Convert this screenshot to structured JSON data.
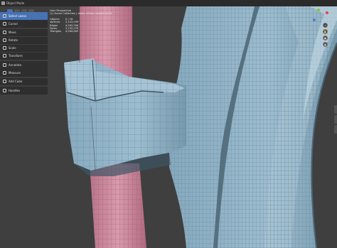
{
  "header": {
    "mode_label": "Object Mode"
  },
  "toolbar_buttons": [
    "select-box",
    "select-lasso",
    "select-circle",
    "select-tweak"
  ],
  "tools": [
    {
      "label": "Select Lasso",
      "icon": "lasso-select-icon",
      "active": true
    },
    {
      "label": "Cursor",
      "icon": "cursor-icon",
      "active": false
    },
    {
      "label": "Move",
      "icon": "move-icon",
      "active": false
    },
    {
      "label": "Rotate",
      "icon": "rotate-icon",
      "active": false
    },
    {
      "label": "Scale",
      "icon": "scale-icon",
      "active": false
    },
    {
      "label": "Transform",
      "icon": "transform-icon",
      "active": false
    },
    {
      "label": "Annotate",
      "icon": "annotate-icon",
      "active": false
    },
    {
      "label": "Measure",
      "icon": "measure-icon",
      "active": false
    },
    {
      "label": "Add Cube",
      "icon": "add-cube-icon",
      "active": false
    },
    {
      "label": "Handles",
      "icon": "handles-icon",
      "active": false
    }
  ],
  "overlay": {
    "view_name": "User Perspective",
    "collection": "(1) Scene Collection | blade refinen model ref.V3",
    "stats": [
      {
        "key": "Objects",
        "value": "0 / 18"
      },
      {
        "key": "Vertices",
        "value": "2,122,099"
      },
      {
        "key": "Edges",
        "value": "4,263,356"
      },
      {
        "key": "Faces",
        "value": "2,132,076"
      },
      {
        "key": "Triangles",
        "value": "4,264,600"
      }
    ]
  },
  "gizmo": {
    "axes": [
      {
        "name": "x-axis",
        "color": "#e0424a"
      },
      {
        "name": "y-axis",
        "color": "#8cc43a"
      },
      {
        "name": "z-axis",
        "color": "#4a7fe0"
      }
    ],
    "buttons": [
      {
        "icon": "zoom-icon",
        "glyph": "+"
      },
      {
        "icon": "hand-pan-icon",
        "glyph": "✋"
      },
      {
        "icon": "camera-icon",
        "glyph": "▣"
      },
      {
        "icon": "grid-icon",
        "glyph": "▦"
      }
    ]
  },
  "colors": {
    "mesh": "#8fb0c4",
    "mesh_dark": "#6d8ea3",
    "handle": "#d08ea3",
    "viewport_bg": "#3f3f3f",
    "accent": "#4772b3"
  }
}
